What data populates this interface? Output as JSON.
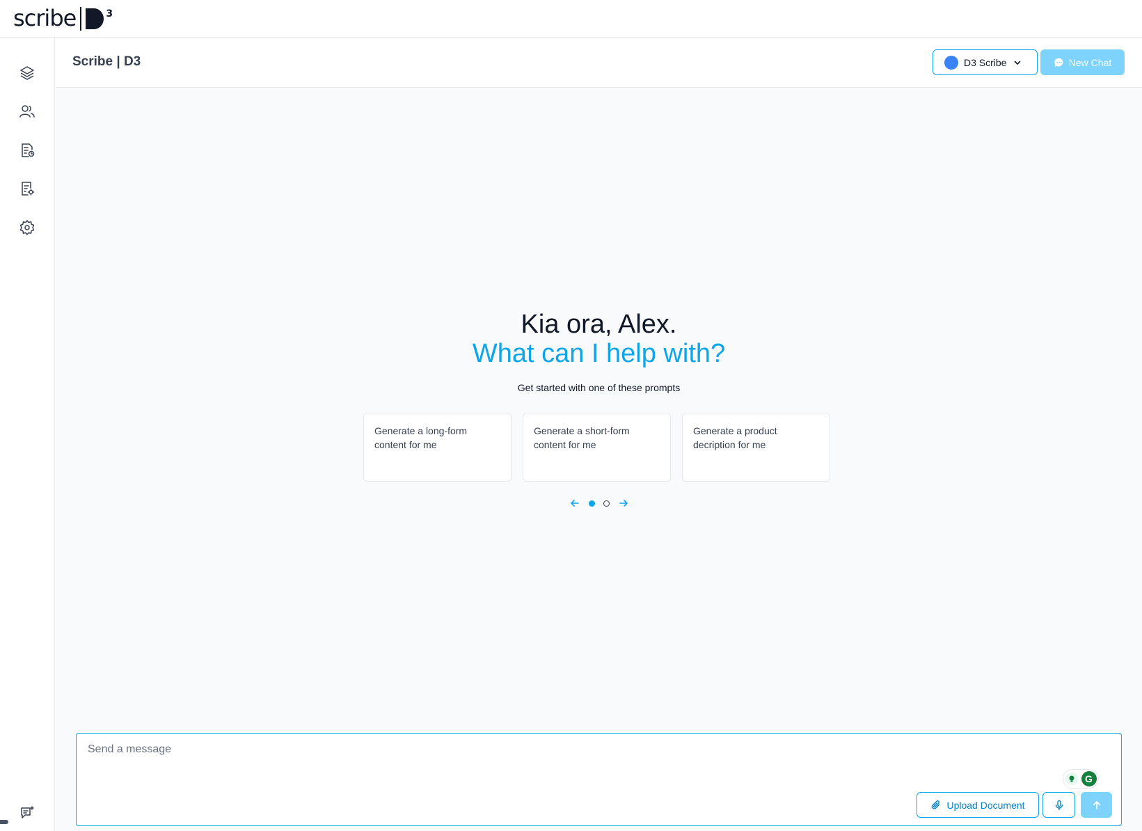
{
  "brand": {
    "word": "scribe",
    "mark": "D",
    "superscript": "3"
  },
  "sidebar": {
    "items": [
      {
        "name": "layers-icon"
      },
      {
        "name": "users-icon"
      },
      {
        "name": "document-search-icon"
      },
      {
        "name": "document-settings-icon"
      },
      {
        "name": "gear-icon"
      },
      {
        "name": "feedback-icon"
      }
    ]
  },
  "header": {
    "title": "Scribe | D3",
    "model_select": {
      "label": "D3 Scribe",
      "dot_color": "#3b82f6"
    },
    "new_chat_label": "New Chat"
  },
  "main": {
    "greeting_line1": "Kia ora, Alex.",
    "greeting_line2": "What can I help with?",
    "subtitle": "Get started with one of these prompts",
    "prompts": [
      "Generate a long-form content for me",
      "Generate a short-form content for me",
      "Generate a product decription for me"
    ],
    "pager": {
      "pages": 2,
      "current": 1
    }
  },
  "composer": {
    "placeholder": "Send a message",
    "upload_label": "Upload Document"
  },
  "colors": {
    "accent": "#0ea5e9",
    "accent_light": "#7dd3fc",
    "text": "#111827",
    "background": "#f8fafc"
  }
}
